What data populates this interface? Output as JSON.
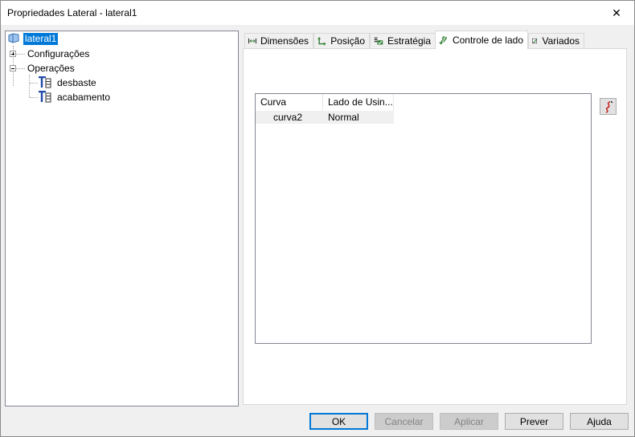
{
  "window": {
    "title": "Propriedades Lateral - lateral1",
    "close_glyph": "✕"
  },
  "tree": {
    "root": {
      "label": "lateral1",
      "icon": "lateral-feature-icon"
    },
    "items": [
      {
        "label": "Configurações",
        "expander": "plus"
      },
      {
        "label": "Operações",
        "expander": "minus"
      }
    ],
    "operations": [
      {
        "label": "desbaste",
        "icon": "tool-operation-icon"
      },
      {
        "label": "acabamento",
        "icon": "tool-operation-icon"
      }
    ]
  },
  "tabs": [
    {
      "label": "Dimensões",
      "icon": "dimensions-icon"
    },
    {
      "label": "Posição",
      "icon": "position-icon"
    },
    {
      "label": "Estratégia",
      "icon": "strategy-icon"
    },
    {
      "label": "Controle de lado",
      "icon": "side-control-icon",
      "active": true
    },
    {
      "label": "Variados",
      "icon": "misc-icon"
    }
  ],
  "table": {
    "columns": [
      "Curva",
      "Lado de Usin..."
    ],
    "rows": [
      {
        "curva": "curva2",
        "lado": "Normal"
      }
    ]
  },
  "buttons": {
    "ok": "OK",
    "cancel": "Cancelar",
    "apply": "Aplicar",
    "preview": "Prever",
    "help": "Ajuda"
  },
  "colors": {
    "selection": "#0078d7",
    "tab_icon_green": "#2e7d32",
    "tool_icon_blue": "#1f4aa8"
  }
}
